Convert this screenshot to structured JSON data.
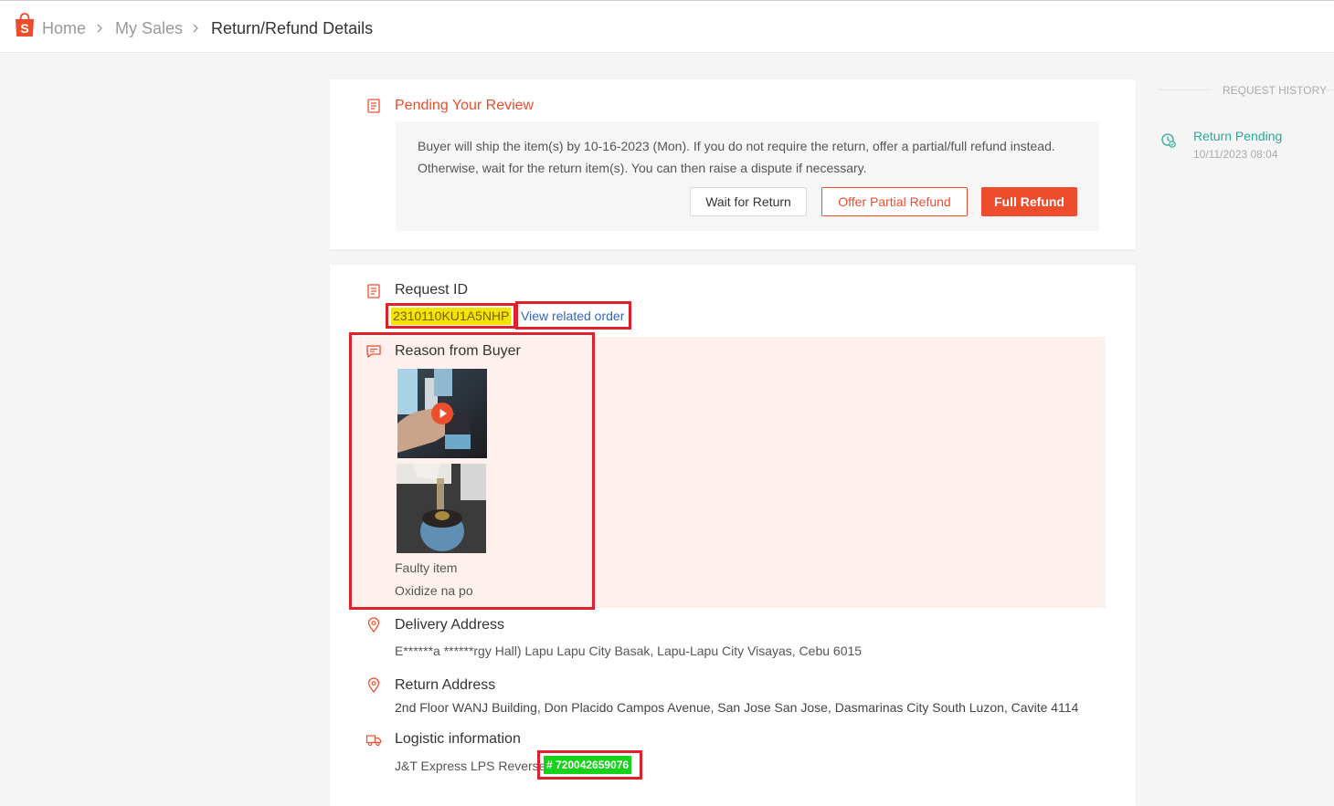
{
  "breadcrumb": {
    "home": "Home",
    "my_sales": "My Sales",
    "current": "Return/Refund Details"
  },
  "review": {
    "title": "Pending Your Review",
    "line1": "Buyer will ship the item(s) by 10-16-2023 (Mon). If you do not require the return, offer a partial/full refund instead.",
    "line2": "Otherwise, wait for the return item(s). You can then raise a dispute if necessary.",
    "wait_label": "Wait for Return",
    "partial_label": "Offer Partial Refund",
    "full_label": "Full Refund"
  },
  "details": {
    "request_id_title": "Request ID",
    "request_id": "2310110KU1A5NHP",
    "view_order_label": "View related order",
    "reason_title": "Reason from Buyer",
    "reason": "Faulty item",
    "reason_note": "Oxidize na po",
    "delivery_title": "Delivery Address",
    "delivery_address": "E******a ******rgy Hall) Lapu Lapu City Basak, Lapu-Lapu City Visayas, Cebu 6015",
    "return_title": "Return Address",
    "return_address": "2nd Floor WANJ Building, Don Placido Campos Avenue, San Jose San Jose, Dasmarinas City South Luzon, Cavite 4114",
    "logistic_title": "Logistic information",
    "carrier": "J&T Express LPS Reverse",
    "tracking": "# 720042659076"
  },
  "history": {
    "title": "REQUEST HISTORY",
    "status": "Return Pending",
    "time": "10/11/2023 08:04"
  },
  "colors": {
    "brand": "#ee4d2d",
    "success": "#26aa99",
    "link": "#3466c2",
    "highlight_yellow": "#f5e400",
    "highlight_green": "#17d21b",
    "annotation_red": "#e0202a",
    "reason_bg": "#fdf0ed"
  },
  "icons": [
    "shopee-bag-icon",
    "chevron-right-icon",
    "document-icon",
    "chat-icon",
    "location-pin-icon",
    "truck-icon",
    "history-icon",
    "play-icon"
  ]
}
